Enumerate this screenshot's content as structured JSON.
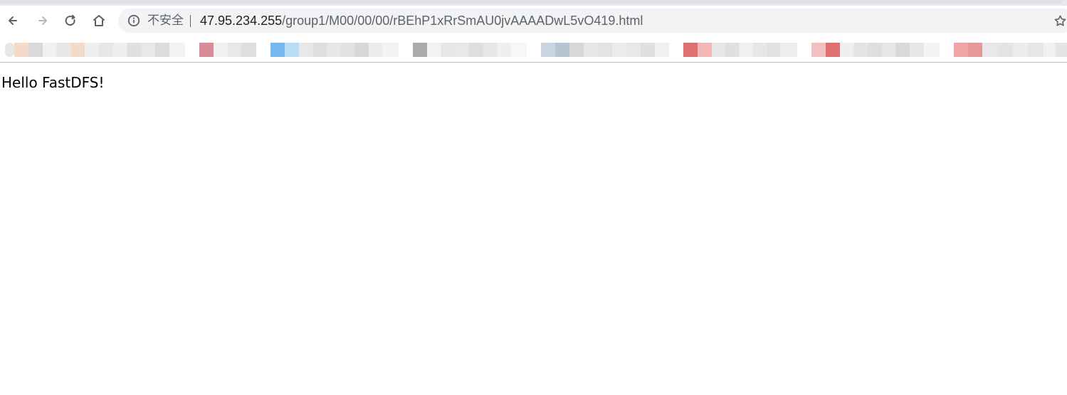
{
  "browser": {
    "navigation": {
      "back_icon": "arrow-left-icon",
      "forward_icon": "arrow-right-icon",
      "reload_icon": "reload-icon",
      "home_icon": "home-icon"
    },
    "address_bar": {
      "security_label": "不安全",
      "url_host": "47.95.234.255",
      "url_path": "/group1/M00/00/00/rBEhP1xRrSmAU0jvAAAADwL5vO419.html",
      "info_icon": "info-icon",
      "bookmark_icon": "star-icon"
    },
    "bookmarks_bar": {
      "items": [
        {
          "color": "#f4dac9"
        },
        {
          "color": "#e7e7e7"
        },
        {
          "color": "#d98c97"
        },
        {
          "color": "#77b7f0"
        },
        {
          "color": "#b8dcf6"
        },
        {
          "color": "#aaaaaa"
        },
        {
          "color": "#c8d4e0"
        },
        {
          "color": "#e07070"
        },
        {
          "color": "#f1b7b7"
        },
        {
          "color": "#e07070"
        },
        {
          "color": "#f0a6a6"
        }
      ]
    }
  },
  "page": {
    "content_text": "Hello FastDFS!"
  },
  "colors": {
    "omnibox_background": "#f1f3f4",
    "toolbar_background": "#ffffff",
    "tab_strip_background": "#dee1e6",
    "text_primary": "#202124",
    "text_secondary": "#5f6368",
    "page_background": "#ffffff",
    "bookmark_bar_divider": "#bdbdbd"
  }
}
